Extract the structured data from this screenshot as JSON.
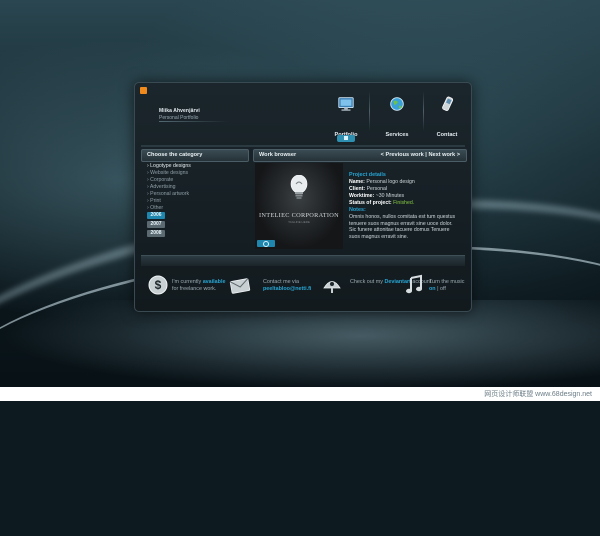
{
  "brand": {
    "name": "Miika Ahvenjärvi",
    "subtitle": "Personal Portfolio"
  },
  "nav": {
    "items": [
      {
        "label": "Portfolio",
        "icon": "monitor-icon"
      },
      {
        "label": "Services",
        "icon": "globe-icon"
      },
      {
        "label": "Contact",
        "icon": "phone-icon"
      }
    ]
  },
  "categories": {
    "title": "Choose the category",
    "items": [
      "Logotype designs",
      "Website designs",
      "Corporate",
      "Advertising",
      "Personal artwork",
      "Print",
      "Other"
    ],
    "years": [
      "2006",
      "2007",
      "2008"
    ]
  },
  "work_browser": {
    "title": "Work browser",
    "previous": "< Previous work",
    "separator": "|",
    "next": "Next work >",
    "image_logo_text": "INTELIEC CORPORATION",
    "image_tagline": "TAGLINE HERE",
    "details_heading": "Project details",
    "name_label": "Name:",
    "name_value": "Personal logo design",
    "client_label": "Client:",
    "client_value": "Personal",
    "worktime_label": "Worktime:",
    "worktime_value": "~30 Minutes",
    "status_label": "Status of project:",
    "status_value": "Finished.",
    "notes_heading": "Notes:",
    "notes_text": "Omnis honos, nullos comitata est tum questus tenuere suos magnus erravit sine uoce dolor. Sic funere attonitae tacuere domus Tenuere suos magnus erravit sine."
  },
  "footer": {
    "available_pre": "I'm currently",
    "available_word": "available",
    "available_post": "for freelance work.",
    "contact_pre": "Contact me via",
    "contact_email": "peeltabloo@netti.fi",
    "deviant_pre": "Check out my",
    "deviant_word": "Deviantart",
    "deviant_post": "account.",
    "music_pre": "Turn the music",
    "music_on": "on",
    "music_sep": "|",
    "music_off": "off"
  },
  "site_credit": "网页设计师联盟 www.68design.net",
  "colors": {
    "accent": "#27a4d2",
    "status_finished": "#84c740",
    "rss": "#f08a1c"
  }
}
